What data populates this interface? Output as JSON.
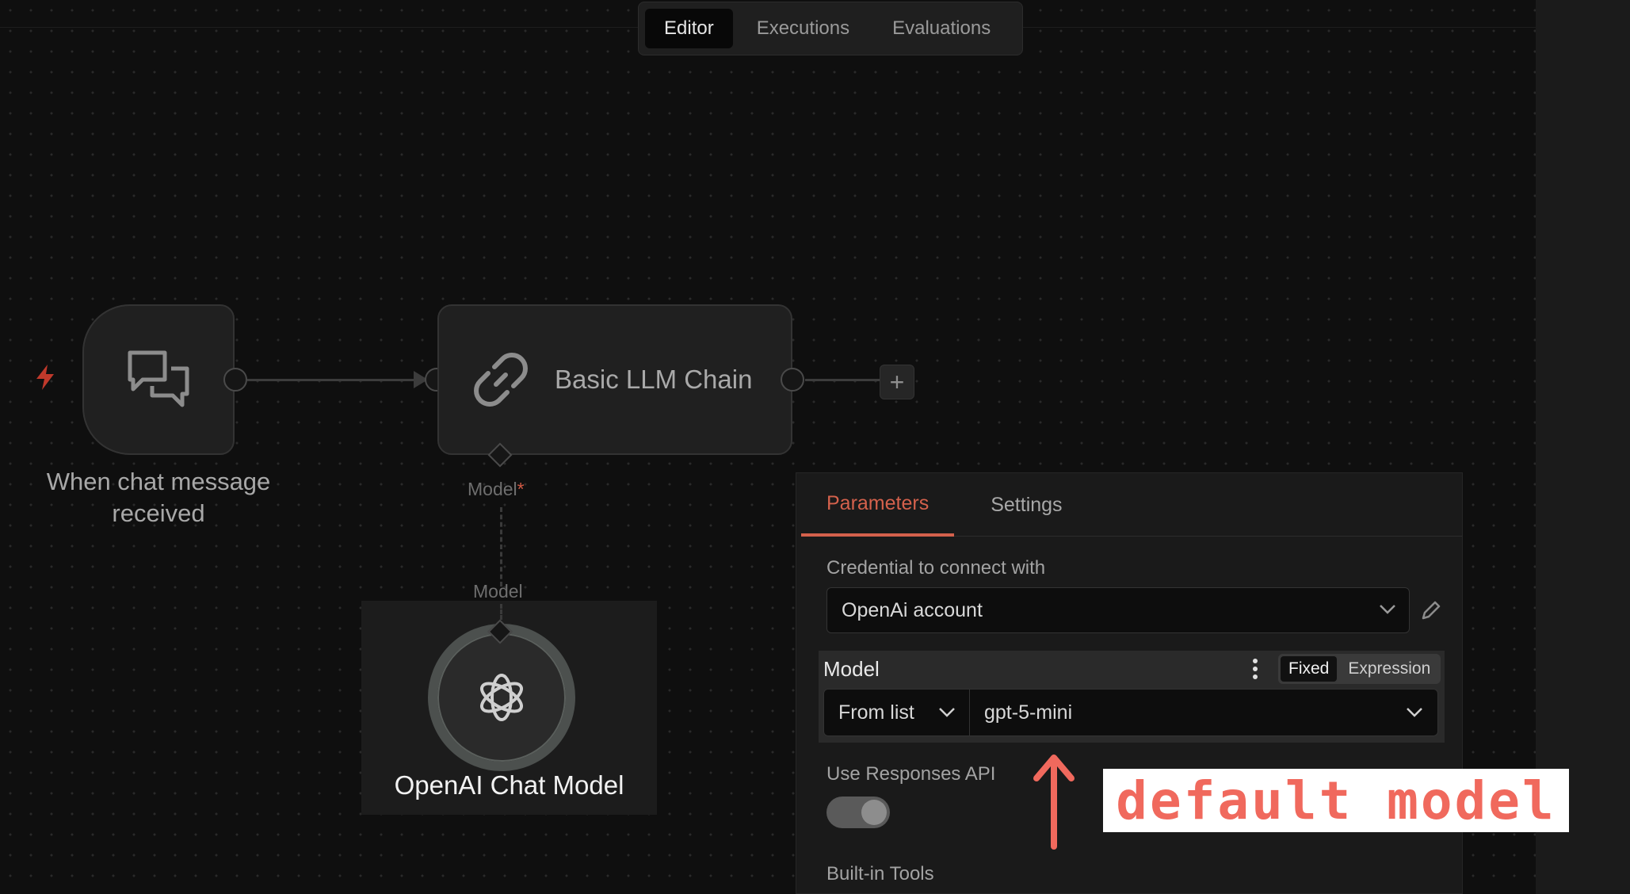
{
  "tabs": [
    "Editor",
    "Executions",
    "Evaluations"
  ],
  "nodes": {
    "chat_trigger": {
      "label": "When chat message received",
      "icon": "chat-bubbles-icon"
    },
    "llm_chain": {
      "label": "Basic LLM Chain",
      "icon": "link-icon"
    },
    "chat_model": {
      "label": "OpenAI Chat Model",
      "icon": "openai-icon"
    }
  },
  "connectors": {
    "chain_model_input": "Model",
    "required_mark": "*",
    "model_output": "Model"
  },
  "panel": {
    "tabs": [
      "Parameters",
      "Settings"
    ],
    "credential_label": "Credential to connect with",
    "credential_value": "OpenAi account",
    "model_label": "Model",
    "mode_options": [
      "Fixed",
      "Expression"
    ],
    "model_source": "From list",
    "model_value": "gpt-5-mini",
    "responses_api_label": "Use Responses API",
    "responses_api_enabled": true,
    "builtin_tools_label": "Built-in Tools"
  },
  "annotation": {
    "text": "default model"
  },
  "colors": {
    "accent": "#d4614c",
    "annotation": "#f0695d",
    "background": "#0f0f0f"
  }
}
